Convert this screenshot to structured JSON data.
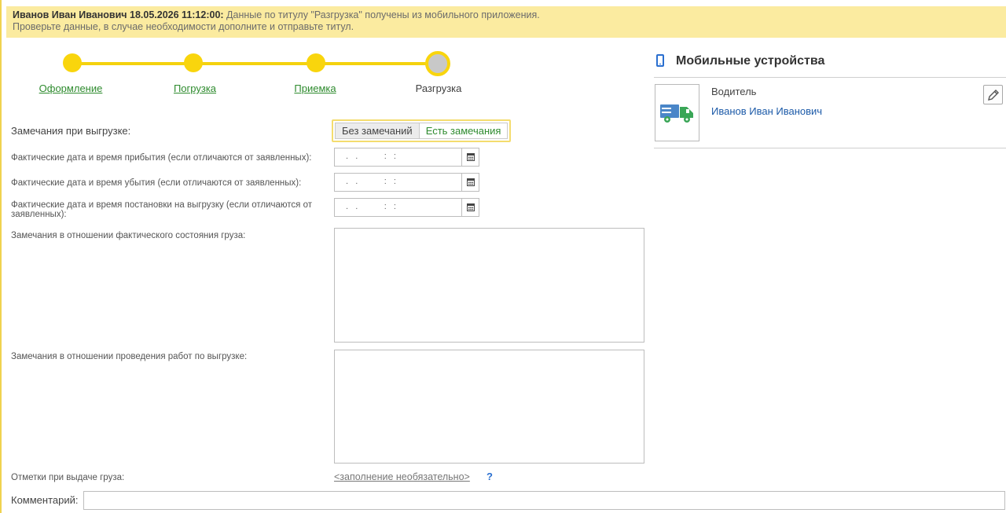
{
  "banner": {
    "author_time": "Иванов Иван Иванович 18.05.2026 11:12:00:",
    "message_line1": "Данные по титулу \"Разгрузка\" получены из мобильного приложения.",
    "message_line2": "Проверьте данные, в случае необходимости дополните и отправьте титул."
  },
  "stepper": {
    "steps": [
      {
        "label": "Оформление",
        "state": "done"
      },
      {
        "label": "Погрузка",
        "state": "done"
      },
      {
        "label": "Приемка",
        "state": "done"
      },
      {
        "label": "Разгрузка",
        "state": "current"
      }
    ],
    "accent": "#f9d50d"
  },
  "form": {
    "remarks_label": "Замечания при выгрузке:",
    "remarks_toggle": {
      "options": [
        "Без замечаний",
        "Есть замечания"
      ],
      "selected": "Без замечаний"
    },
    "arrival_label": "Фактические дата и время прибытия (если отличаются от заявленных):",
    "departure_label": "Фактические дата и время убытия (если отличаются от заявленных):",
    "placement_label_1": "Фактические дата и время постановки на выгрузку (если отличаются от",
    "placement_label_2": "заявленных):",
    "date_mask": " .  .        :  :  ",
    "cargo_state_label": "Замечания в отношении фактического состояния груза:",
    "cargo_state_value": "",
    "unloading_works_label": "Замечания в отношении проведения работ по выгрузке:",
    "unloading_works_value": "",
    "issue_marks_label": "Отметки при выдаче груза:",
    "issue_marks_link": "<заполнение необязательно>",
    "help_glyph": "?",
    "comment_label": "Комментарий:",
    "comment_value": ""
  },
  "mobile": {
    "title": "Мобильные устройства",
    "driver_role": "Водитель",
    "driver_name": "Иванов Иван Иванович",
    "icons": [
      "mobile-phone-icon",
      "truck-icon",
      "pencil-icon",
      "calendar-icon"
    ]
  },
  "colors": {
    "banner_bg": "#fbeba0",
    "link_green": "#2e8b2e",
    "link_blue": "#1c5aa8"
  }
}
